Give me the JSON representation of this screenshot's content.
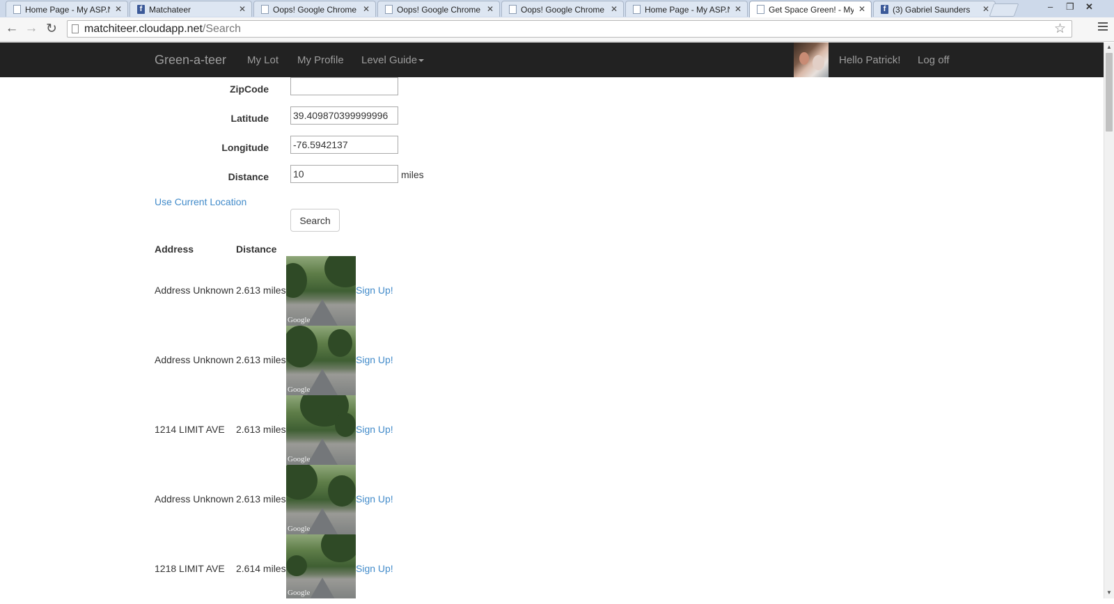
{
  "browser": {
    "tabs": [
      {
        "title": "Home Page - My ASP.N",
        "favicon": "page-icon",
        "active": false
      },
      {
        "title": "Matchateer",
        "favicon": "facebook-icon",
        "active": false
      },
      {
        "title": "Oops! Google Chrome c",
        "favicon": "page-icon",
        "active": false
      },
      {
        "title": "Oops! Google Chrome c",
        "favicon": "page-icon",
        "active": false
      },
      {
        "title": "Oops! Google Chrome c",
        "favicon": "page-icon",
        "active": false
      },
      {
        "title": "Home Page - My ASP.N",
        "favicon": "page-icon",
        "active": false
      },
      {
        "title": "Get Space Green! - My A",
        "favicon": "page-icon",
        "active": true
      },
      {
        "title": "(3) Gabriel Saunders",
        "favicon": "facebook-icon",
        "active": false
      }
    ],
    "url_host": "matchiteer.cloudapp.net",
    "url_path": "/Search"
  },
  "nav": {
    "brand": "Green-a-teer",
    "links": [
      "My Lot",
      "My Profile",
      "Level Guide"
    ],
    "greeting": "Hello Patrick!",
    "logoff": "Log off"
  },
  "form": {
    "zipcode_label": "ZipCode",
    "zipcode_value": "",
    "latitude_label": "Latitude",
    "latitude_value": "39.409870399999996",
    "longitude_label": "Longitude",
    "longitude_value": "-76.5942137",
    "distance_label": "Distance",
    "distance_value": "10",
    "distance_unit": "miles",
    "use_location": "Use Current Location",
    "search_button": "Search"
  },
  "results": {
    "headers": [
      "Address",
      "Distance"
    ],
    "rows": [
      {
        "address": "Address Unknown",
        "distance": "2.613 miles",
        "action": "Sign Up!",
        "image_label": "Google"
      },
      {
        "address": "Address Unknown",
        "distance": "2.613 miles",
        "action": "Sign Up!",
        "image_label": "Google"
      },
      {
        "address": "1214 LIMIT AVE",
        "distance": "2.613 miles",
        "action": "Sign Up!",
        "image_label": "Google"
      },
      {
        "address": "Address Unknown",
        "distance": "2.613 miles",
        "action": "Sign Up!",
        "image_label": "Google"
      },
      {
        "address": "1218 LIMIT AVE",
        "distance": "2.614 miles",
        "action": "Sign Up!",
        "image_label": "Google"
      }
    ]
  },
  "colors": {
    "navbar_bg": "#222222",
    "nav_text": "#9d9d9d",
    "link": "#428bca"
  }
}
